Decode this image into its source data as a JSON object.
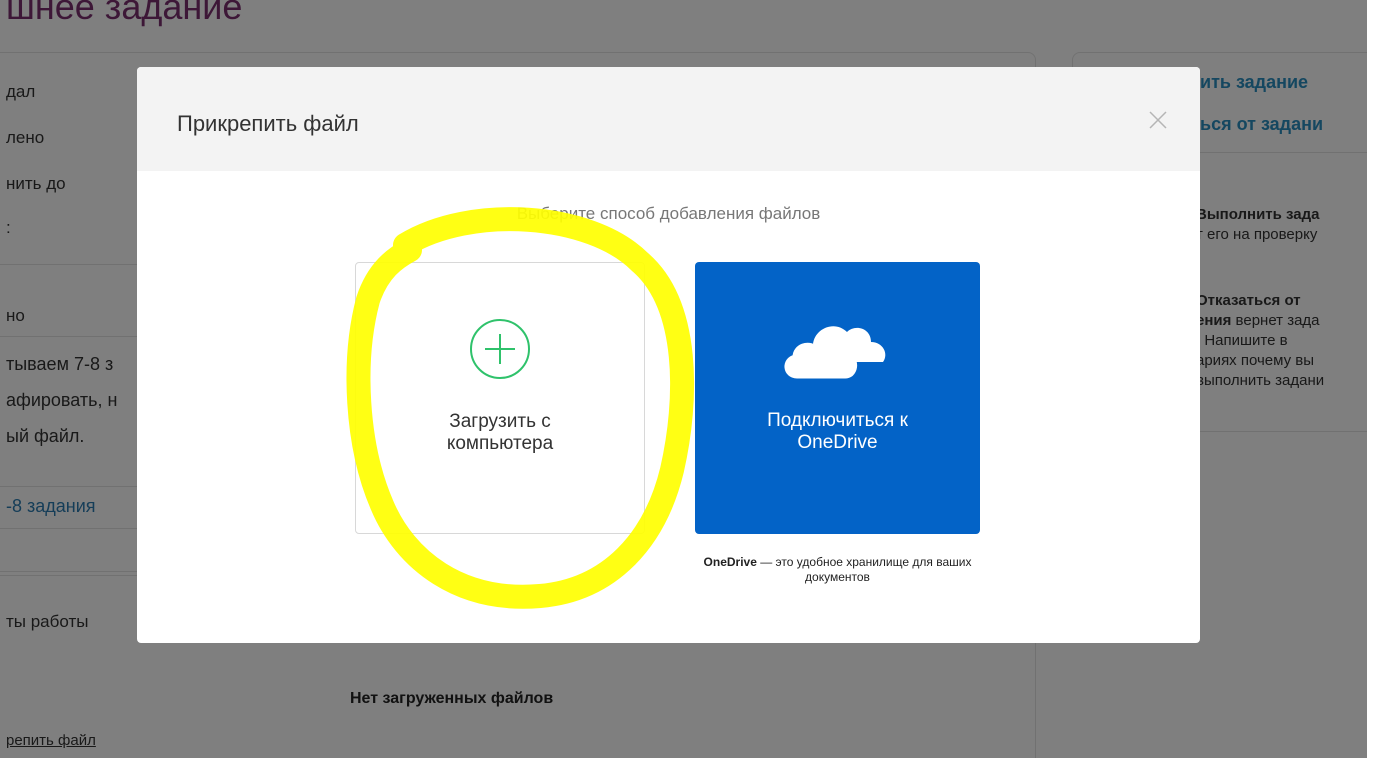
{
  "background": {
    "page_title": "шнее задание",
    "meta_rows": [
      "дал",
      "лено",
      "нить до",
      ":"
    ],
    "section_label": "но",
    "description_lines": [
      "тываем 7-8 з",
      "афировать, н",
      "ый файл."
    ],
    "task_link": "-8 задания",
    "results_label": "ты работы",
    "no_files": "Нет загруженных файлов",
    "attach_link": "репить файл",
    "right_panel": {
      "link1": "ить задание",
      "link2": "ься от задани",
      "text1_bold": "Выполнить зада",
      "text1_rest": "т его на проверку",
      "text1_dot": ".",
      "text2_bold1": "Отказаться от",
      "text2_bold2": "ения",
      "text2_rest": " вернет зада",
      "text2_l2": ". Напишите в",
      "text2_l3": "ариях почему вы",
      "text2_l4": "выполнить задани"
    }
  },
  "modal": {
    "title": "Прикрепить файл",
    "subtitle": "Выберите способ добавления файлов",
    "upload_option": {
      "label": "Загрузить с\nкомпьютера",
      "icon": "plus-circle-icon",
      "icon_color": "#2fc26b"
    },
    "onedrive_option": {
      "label": "Подключиться к\nOneDrive",
      "icon": "cloud-icon",
      "bg_color": "#0363c7"
    },
    "onedrive_note_bold": "OneDrive",
    "onedrive_note_rest": " — это удобное хранилище для ваших документов"
  },
  "annotation": {
    "color": "#ffff00"
  }
}
